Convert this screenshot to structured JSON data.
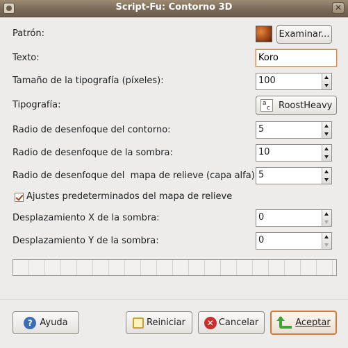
{
  "window": {
    "title": "Script-Fu: Contorno 3D",
    "close_symbol": "✕",
    "app_icon": "gimp-icon"
  },
  "fields": {
    "pattern": {
      "label": "Patrón:",
      "browse_label": "Examinar..."
    },
    "text": {
      "label": "Texto:",
      "value": "Koro"
    },
    "font_size": {
      "label": "Tamaño de la tipografía (píxeles):",
      "value": "100"
    },
    "font": {
      "label": "Tipografía:",
      "value": "RoostHeavy",
      "icon_text_top": "a",
      "icon_text_bottom": "c"
    },
    "outline_blur": {
      "label": "Radio de desenfoque del contorno:",
      "value": "5"
    },
    "shadow_blur": {
      "label": "Radio de desenfoque de la sombra:",
      "value": "10"
    },
    "bumpmap_blur": {
      "label": "Radio de desenfoque del  mapa de relieve (capa alfa):",
      "value": "5"
    },
    "default_bumpmap": {
      "label": "Ajustes predeterminados del mapa de relieve",
      "checked": true
    },
    "shadow_x": {
      "label": "Desplazamiento X de la sombra:",
      "value": "0"
    },
    "shadow_y": {
      "label": "Desplazamiento Y de la sombra:",
      "value": "0"
    }
  },
  "buttons": {
    "help": "Ayuda",
    "reset": "Reiniciar",
    "cancel": "Cancelar",
    "ok": "Aceptar"
  },
  "colors": {
    "titlebar": "#7a6a57",
    "focus_border": "#d28a45",
    "default_button_border": "#cf7a39"
  }
}
